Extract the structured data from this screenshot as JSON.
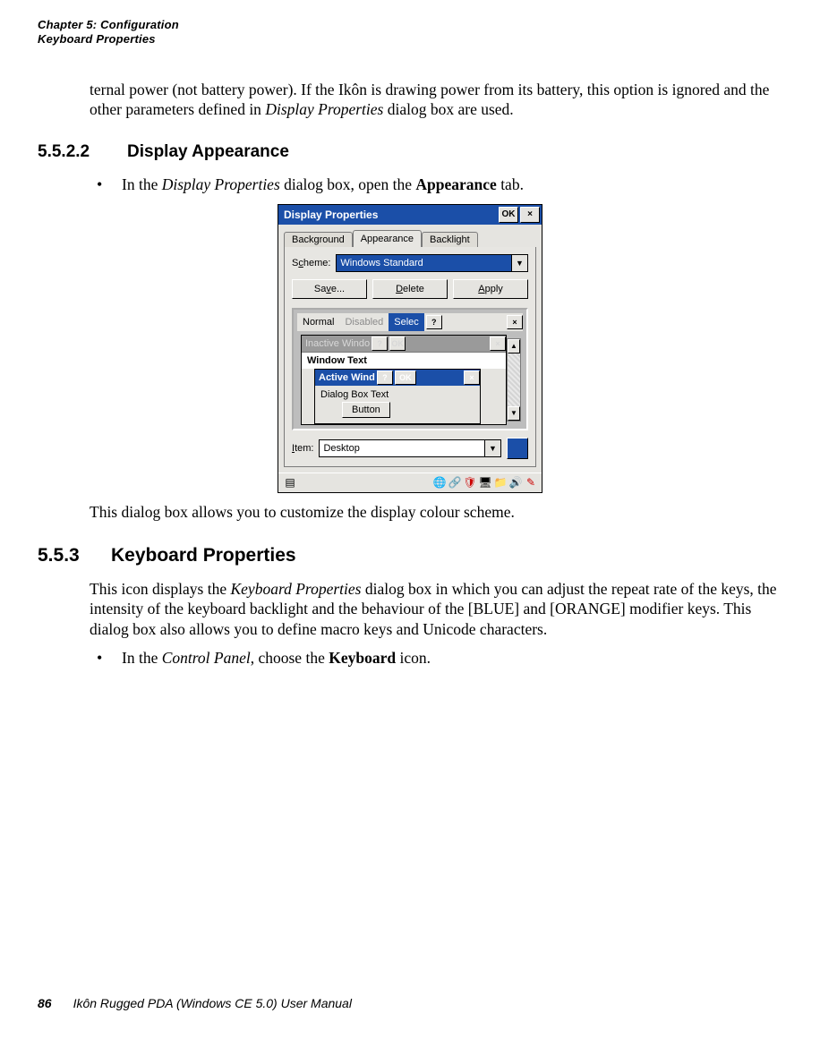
{
  "header": {
    "chapter": "Chapter 5:  Configuration",
    "section": "Keyboard Properties"
  },
  "intro": {
    "p0": "ternal power (not battery power). If the Ikôn is drawing power from its battery, this option is ignored and the other parameters defined in ",
    "p0_em": "Display Properties",
    "p0_end": " dialog box are used."
  },
  "sec_5522": {
    "num": "5.5.2.2",
    "title": "Display Appearance",
    "bul_pre": "In the ",
    "bul_em": "Display Properties",
    "bul_mid": " dialog box, open the ",
    "bul_bold": "Appearance",
    "bul_end": " tab.",
    "p_after": "This dialog box allows you to customize the display colour scheme."
  },
  "dlg": {
    "title": "Display Properties",
    "ok": "OK",
    "close": "×",
    "tabs": [
      "Background",
      "Appearance",
      "Backlight"
    ],
    "scheme_label": "Scheme:",
    "scheme_value": "Windows Standard",
    "buttons": {
      "save": "Save...",
      "delete": "Delete",
      "apply": "Apply"
    },
    "preview": {
      "tabs_row": {
        "normal": "Normal",
        "disabled": "Disabled",
        "selected": "Selec"
      },
      "q": "?",
      "x": "×",
      "inactive": "Inactive Windo",
      "ok_sm": "OK",
      "window_text": "Window Text",
      "active": "Active Wind",
      "dialog_txt": "Dialog Box Text",
      "button": "Button",
      "scroll_up": "▲",
      "scroll_dn": "▼"
    },
    "item_label": "Item:",
    "item_value": "Desktop"
  },
  "sec_553": {
    "num": "5.5.3",
    "title": "Keyboard Properties",
    "p1a": "This icon displays the ",
    "p1a_em": "Keyboard Properties",
    "p1b": " dialog box in which you can adjust the repeat rate of the keys, the intensity of the keyboard backlight and the behaviour of the [BLUE] and [ORANGE] modifier keys. This dialog box also allows you to define macro keys and Unicode characters.",
    "bul_pre": "In the ",
    "bul_em": "Control Panel",
    "bul_mid": ", choose the ",
    "bul_bold": "Keyboard",
    "bul_end": " icon."
  },
  "footer": {
    "page": "86",
    "title": "Ikôn Rugged PDA (Windows CE 5.0) User Manual"
  }
}
